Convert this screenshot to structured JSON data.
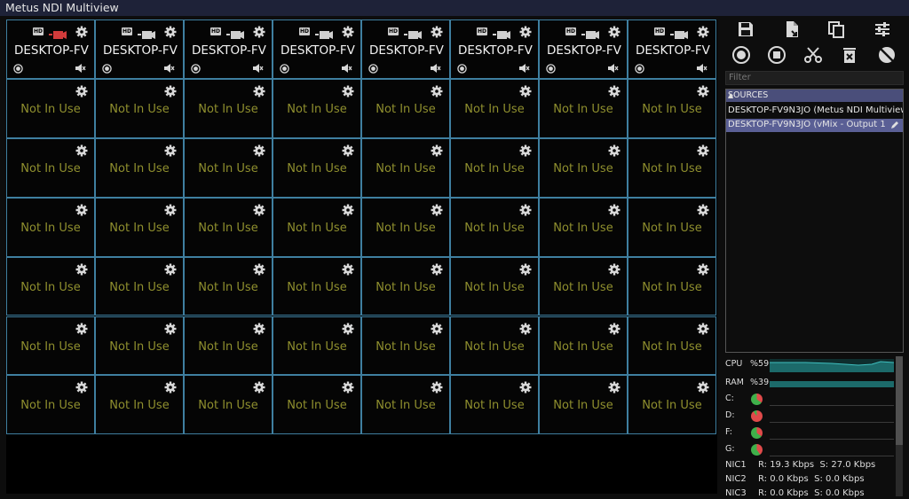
{
  "window": {
    "title": "Metus NDI Multiview"
  },
  "grid": {
    "columns": 8,
    "rows": 7,
    "sources": [
      {
        "name": "DESKTOP-FV",
        "camera_state": "red"
      },
      {
        "name": "DESKTOP-FV",
        "camera_state": "gray"
      },
      {
        "name": "DESKTOP-FV",
        "camera_state": "gray"
      },
      {
        "name": "DESKTOP-FV",
        "camera_state": "gray"
      },
      {
        "name": "DESKTOP-FV",
        "camera_state": "gray"
      },
      {
        "name": "DESKTOP-FV",
        "camera_state": "gray"
      },
      {
        "name": "DESKTOP-FV",
        "camera_state": "gray"
      },
      {
        "name": "DESKTOP-FV",
        "camera_state": "gray"
      }
    ],
    "hd_badge": "HD",
    "empty_label": "Not In Use"
  },
  "toolbar": {
    "row1": [
      "save-icon",
      "export-file-icon",
      "copy-icon",
      "sliders-icon"
    ],
    "row2": [
      "record-icon",
      "stop-icon",
      "cut-icon",
      "delete-icon",
      "hide-icon"
    ]
  },
  "filter": {
    "placeholder": "Filter"
  },
  "sources_panel": {
    "header": "SOURCES",
    "items": [
      {
        "label": "DESKTOP-FV9N3JO (Metus NDI Multiview",
        "selected": false
      },
      {
        "label": "DESKTOP-FV9N3JO (vMix - Output 1",
        "selected": true
      }
    ]
  },
  "stats": {
    "cpu_label": "CPU",
    "cpu_value": "%59",
    "ram_label": "RAM",
    "ram_value": "%39",
    "drives": [
      {
        "label": "C:",
        "used_fraction": 0.35
      },
      {
        "label": "D:",
        "used_fraction": 0.9
      },
      {
        "label": "F:",
        "used_fraction": 0.35
      },
      {
        "label": "G:",
        "used_fraction": 0.4
      }
    ],
    "nics": [
      {
        "label": "NIC1",
        "text": "R: 19.3 Kbps  S: 27.0 Kbps"
      },
      {
        "label": "NIC2",
        "text": "R: 0.0 Kbps  S: 0.0 Kbps"
      },
      {
        "label": "NIC3",
        "text": "R: 0.0 Kbps  S: 0.0 Kbps"
      }
    ]
  },
  "colors": {
    "cell_border": "#3f7fa0",
    "empty_text": "#8f8f2e",
    "sources_header": "#4a4e7a",
    "selected_row": "#5a5f95",
    "drive_used": "#e04a4a",
    "drive_free": "#3fb04a"
  }
}
